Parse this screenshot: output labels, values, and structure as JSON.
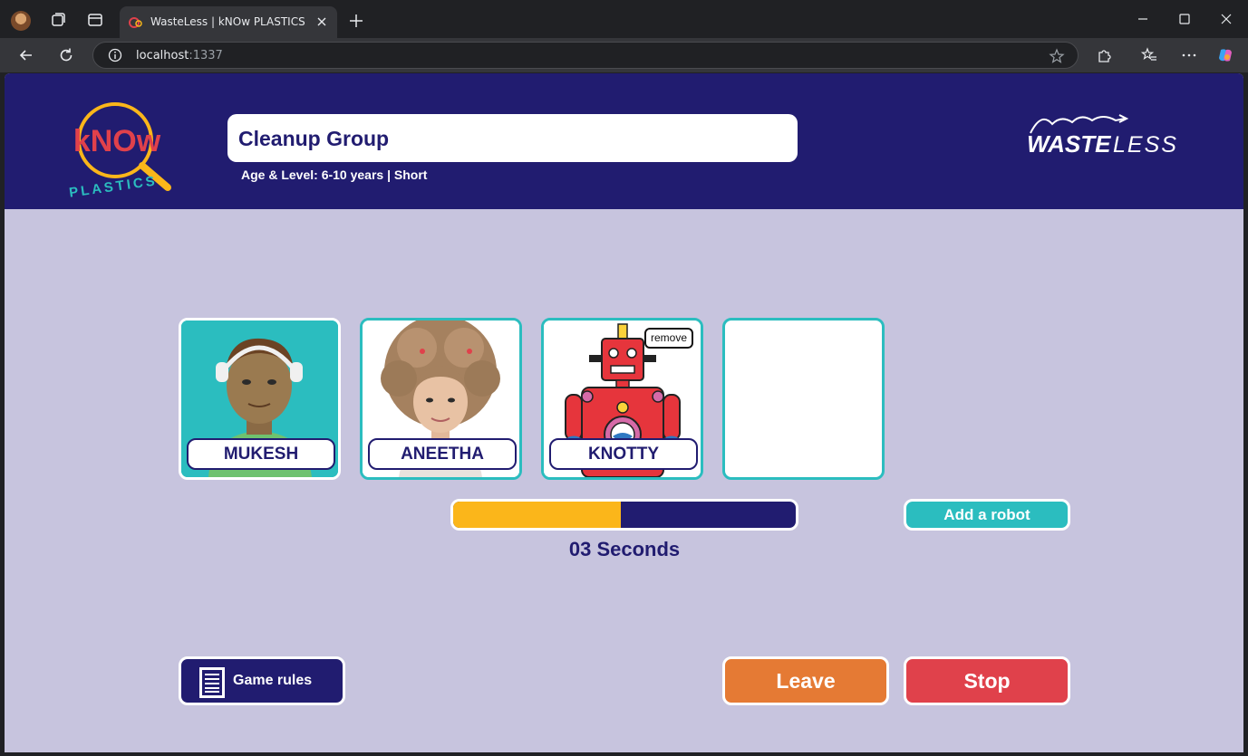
{
  "browser": {
    "tab_title": "WasteLess | kNOw PLASTICS",
    "url_host": "localhost",
    "url_port": ":1337"
  },
  "header": {
    "logo_text": "kNOw",
    "logo_subtext": "PLASTICS",
    "group_name": "Cleanup Group",
    "age_level": "Age & Level: 6-10 years | Short",
    "brand_strong": "WASTE",
    "brand_light": "LESS"
  },
  "players": [
    {
      "name": "MUKESH",
      "avatar": "boy-with-headphones"
    },
    {
      "name": "ANEETHA",
      "avatar": "girl-with-curly-hair"
    },
    {
      "name": "KNOTTY",
      "avatar": "red-robot",
      "remove_label": "remove"
    }
  ],
  "progress": {
    "fraction": 0.49,
    "fill_color": "#fbb61a",
    "track_color": "#211c70"
  },
  "timer_text": "03 Seconds",
  "buttons": {
    "add_robot": "Add a robot",
    "game_rules": "Game rules",
    "leave": "Leave",
    "stop": "Stop"
  },
  "colors": {
    "navy": "#211c70",
    "teal": "#2bbdbf",
    "page_bg": "#c7c4de",
    "orange": "#e57a34",
    "red": "#e0414b"
  }
}
